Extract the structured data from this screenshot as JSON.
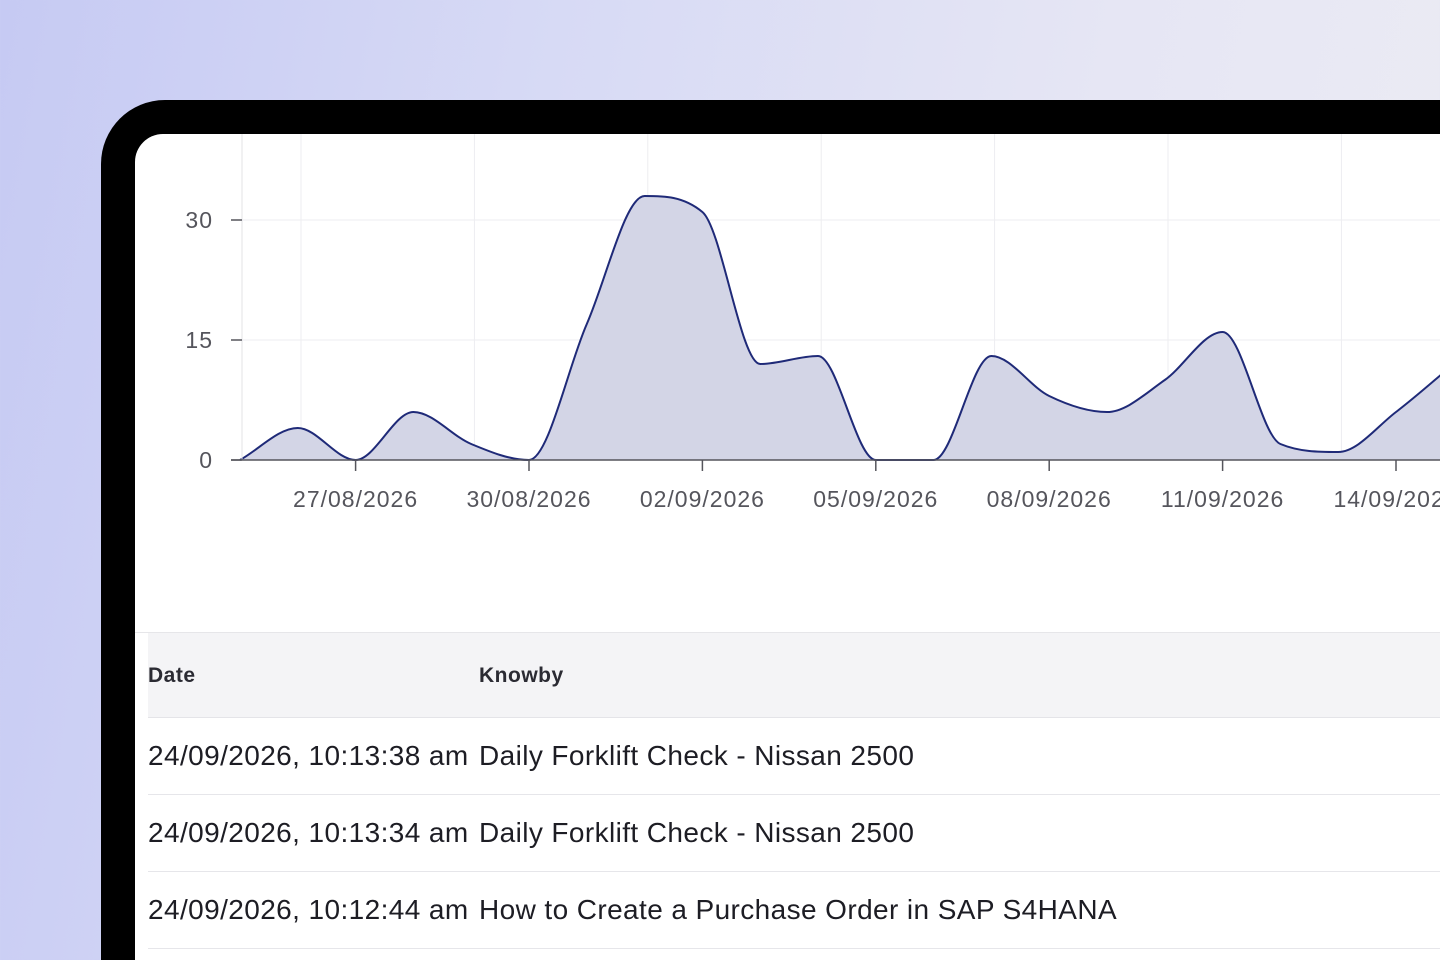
{
  "chart_data": {
    "type": "area",
    "x": [
      "25/08/2026",
      "26/08/2026",
      "27/08/2026",
      "28/08/2026",
      "29/08/2026",
      "30/08/2026",
      "31/08/2026",
      "01/09/2026",
      "02/09/2026",
      "03/09/2026",
      "04/09/2026",
      "05/09/2026",
      "06/09/2026",
      "07/09/2026",
      "08/09/2026",
      "09/09/2026",
      "10/09/2026",
      "11/09/2026",
      "12/09/2026",
      "13/09/2026",
      "14/09/2026",
      "15/09/2026"
    ],
    "values": [
      0,
      4,
      0,
      6,
      2,
      0,
      17,
      33,
      31,
      12,
      13,
      0,
      0,
      13,
      8,
      6,
      10,
      16,
      2,
      1,
      6,
      12
    ],
    "x_tick_labels": [
      "27/08/2026",
      "30/08/2026",
      "02/09/2026",
      "05/09/2026",
      "08/09/2026",
      "11/09/2026",
      "14/09/2026"
    ],
    "y_ticks": [
      0,
      15,
      30
    ],
    "ylim": [
      0,
      34
    ],
    "grid": true,
    "line_color": "#1f2a78",
    "fill_color": "#d3d5e6"
  },
  "table": {
    "columns": {
      "date": "Date",
      "knowby": "Knowby"
    },
    "rows": [
      {
        "date": "24/09/2026, 10:13:38 am",
        "knowby": "Daily Forklift Check - Nissan 2500"
      },
      {
        "date": "24/09/2026, 10:13:34 am",
        "knowby": "Daily Forklift Check - Nissan 2500"
      },
      {
        "date": "24/09/2026, 10:12:44 am",
        "knowby": "How to Create a Purchase Order in SAP S4HANA"
      }
    ]
  }
}
